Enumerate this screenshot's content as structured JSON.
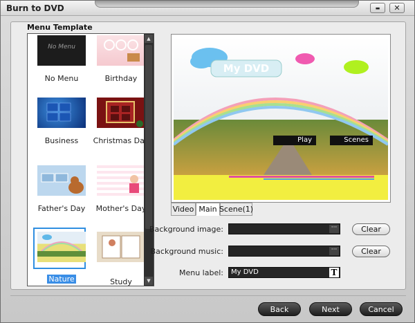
{
  "window": {
    "title": "Burn to DVD",
    "minimize": "▬",
    "close": "✕"
  },
  "menu_template": {
    "heading": "Menu Template",
    "items": [
      {
        "label": "No Menu",
        "thumb_text": "No Menu",
        "selected": false
      },
      {
        "label": "Birthday",
        "selected": false
      },
      {
        "label": "Business",
        "selected": false
      },
      {
        "label": "Christmas Day",
        "selected": false
      },
      {
        "label": "Father's Day",
        "selected": false
      },
      {
        "label": "Mother's Day",
        "selected": false
      },
      {
        "label": "Nature",
        "selected": true
      },
      {
        "label": "Study",
        "selected": false
      }
    ]
  },
  "preview": {
    "title": "My DVD",
    "play": "Play",
    "scenes": "Scenes"
  },
  "tabs": [
    {
      "label": "Video",
      "active": false
    },
    {
      "label": "Main",
      "active": true
    },
    {
      "label": "Scene(1)",
      "active": false
    }
  ],
  "settings": {
    "background_image_label": "Background image:",
    "background_image_value": "",
    "background_music_label": "Background music:",
    "background_music_value": "",
    "menu_label_label": "Menu label:",
    "menu_label_value": "My DVD",
    "browse": "···",
    "text_tool": "T",
    "clear": "Clear"
  },
  "footer": {
    "back": "Back",
    "next": "Next",
    "cancel": "Cancel"
  },
  "colors": {
    "selection": "#3a8ee6",
    "dark_button": "#2a2a2a",
    "panel": "#ececec"
  }
}
